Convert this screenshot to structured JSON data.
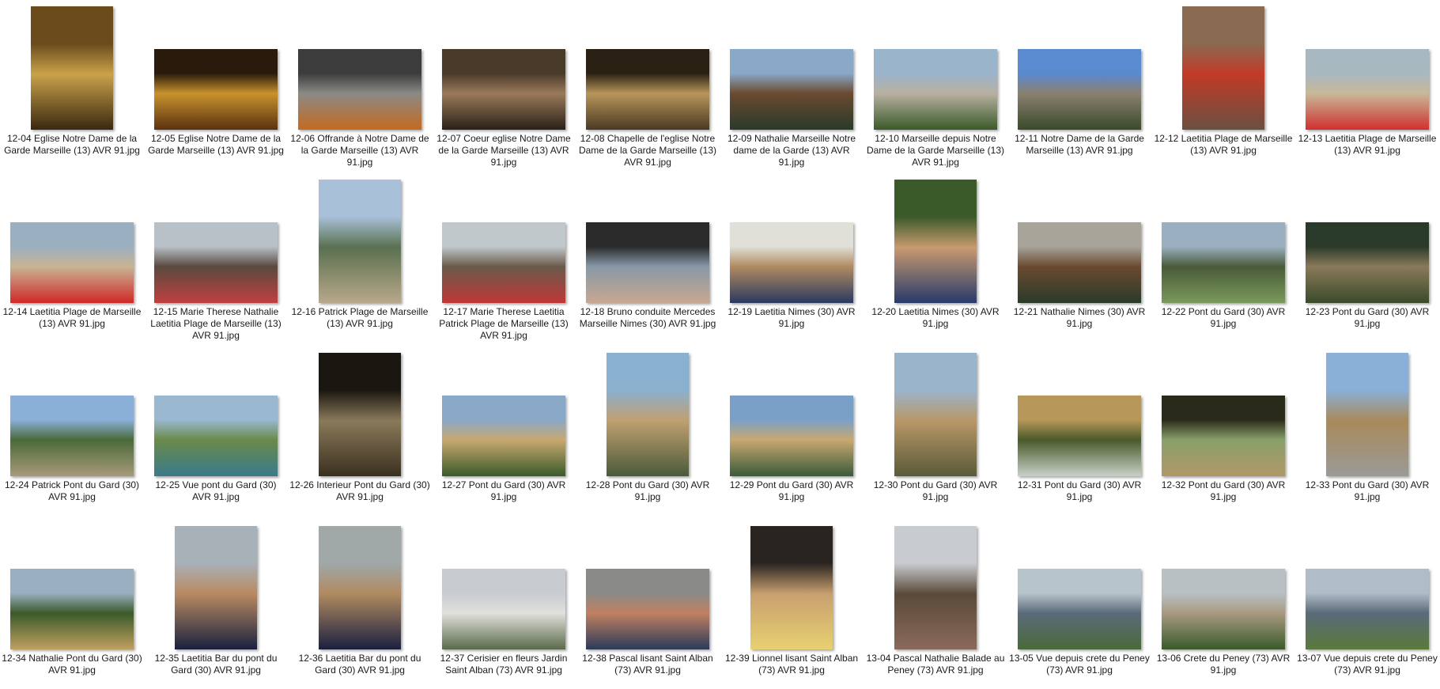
{
  "files": [
    {
      "name": "12-04 Eglise Notre Dame de la Garde Marseille (13) AVR 91.jpg",
      "orient": "v",
      "colors": [
        "#6b4a1c",
        "#c9a24a",
        "#3a2810"
      ]
    },
    {
      "name": "12-05 Eglise Notre Dame de la Garde Marseille (13) AVR 91.jpg",
      "orient": "h",
      "colors": [
        "#2a1a0c",
        "#c8922e",
        "#5a3210"
      ]
    },
    {
      "name": "12-06 Offrande à Notre Dame de la Garde Marseille (13) AVR 91.jpg",
      "orient": "h",
      "colors": [
        "#3c3c3c",
        "#8a8a86",
        "#c46a20"
      ]
    },
    {
      "name": "12-07 Coeur eglise Notre Dame de la Garde Marseille (13) AVR 91.jpg",
      "orient": "h",
      "colors": [
        "#4a3a2a",
        "#9a7a5a",
        "#2a2018"
      ]
    },
    {
      "name": "12-08 Chapelle de l'eglise Notre Dame de la Garde Marseille (13) AVR 91.jpg",
      "orient": "h",
      "colors": [
        "#2a2014",
        "#b8955a",
        "#4a3a22"
      ]
    },
    {
      "name": "12-09 Nathalie Marseille Notre dame de la Garde (13) AVR 91.jpg",
      "orient": "h",
      "colors": [
        "#8aa8c8",
        "#6a4a30",
        "#2a3a2a"
      ]
    },
    {
      "name": "12-10 Marseille depuis Notre Dame de la Garde Marseille (13) AVR 91.jpg",
      "orient": "h",
      "colors": [
        "#9ab4cc",
        "#b8b0a0",
        "#3a5a2a"
      ]
    },
    {
      "name": "12-11 Notre Dame de la Garde Marseille (13) AVR 91.jpg",
      "orient": "h",
      "colors": [
        "#5a8ad0",
        "#8a8070",
        "#3a4a2a"
      ]
    },
    {
      "name": "12-12 Laetitia Plage de Marseille (13) AVR 91.jpg",
      "orient": "v",
      "colors": [
        "#8a6a50",
        "#c23a28",
        "#6a5040"
      ]
    },
    {
      "name": "12-13 Laetitia Plage de Marseille (13) AVR 91.jpg",
      "orient": "h",
      "colors": [
        "#a8b8c0",
        "#c8b898",
        "#d03030"
      ]
    },
    {
      "name": "12-14 Laetitia Plage de Marseille (13) AVR 91.jpg",
      "orient": "h",
      "colors": [
        "#9ab0c0",
        "#c8b494",
        "#d02828"
      ]
    },
    {
      "name": "12-15 Marie Therese Nathalie Laetitia Plage de Marseille (13) AVR 91.jpg",
      "orient": "h",
      "colors": [
        "#b8c0c8",
        "#5a4a40",
        "#c04040"
      ]
    },
    {
      "name": "12-16 Patrick Plage de Marseille (13) AVR 91.jpg",
      "orient": "v",
      "colors": [
        "#a8c0d8",
        "#5a7050",
        "#b8a88a"
      ]
    },
    {
      "name": "12-17 Marie Therese Laetitia Patrick Plage de Marseille (13) AVR 91.jpg",
      "orient": "h",
      "colors": [
        "#c0c8cc",
        "#6a5a4a",
        "#c03838"
      ]
    },
    {
      "name": "12-18 Bruno conduite Mercedes Marseille Nimes (30) AVR 91.jpg",
      "orient": "h",
      "colors": [
        "#2a2a2a",
        "#8898a8",
        "#c8a890"
      ]
    },
    {
      "name": "12-19 Laetitia Nimes (30) AVR 91.jpg",
      "orient": "h",
      "colors": [
        "#e0e0d8",
        "#b08a60",
        "#2a3a60"
      ]
    },
    {
      "name": "12-20 Laetitia Nimes (30) AVR 91.jpg",
      "orient": "v",
      "colors": [
        "#3a5a2a",
        "#c89a70",
        "#283a6a"
      ]
    },
    {
      "name": "12-21 Nathalie Nimes (30) AVR 91.jpg",
      "orient": "h",
      "colors": [
        "#a8a49a",
        "#6a4a30",
        "#2a3a2a"
      ]
    },
    {
      "name": "12-22 Pont du Gard (30) AVR 91.jpg",
      "orient": "h",
      "colors": [
        "#9ab0c0",
        "#4a5a3a",
        "#7a9a5a"
      ]
    },
    {
      "name": "12-23 Pont du Gard (30) AVR 91.jpg",
      "orient": "h",
      "colors": [
        "#2a3a2a",
        "#8a7a5a",
        "#3a4a2a"
      ]
    },
    {
      "name": "12-24 Patrick Pont du Gard (30) AVR 91.jpg",
      "orient": "h",
      "colors": [
        "#8ab0d8",
        "#4a6a3a",
        "#a89a7a"
      ]
    },
    {
      "name": "12-25 Vue pont du Gard (30) AVR 91.jpg",
      "orient": "h",
      "colors": [
        "#9ab8d0",
        "#6a8a4a",
        "#3a7a8a"
      ]
    },
    {
      "name": "12-26 Interieur Pont du Gard (30) AVR 91.jpg",
      "orient": "v",
      "colors": [
        "#1a1610",
        "#8a7a5a",
        "#3a3020"
      ]
    },
    {
      "name": "12-27 Pont du Gard (30) AVR 91.jpg",
      "orient": "h",
      "colors": [
        "#8aa8c8",
        "#c8a870",
        "#3a5a2a"
      ]
    },
    {
      "name": "12-28 Pont du Gard (30) AVR 91.jpg",
      "orient": "v",
      "colors": [
        "#8ab0d0",
        "#c0a070",
        "#4a5a3a"
      ]
    },
    {
      "name": "12-29 Pont du Gard (30) AVR 91.jpg",
      "orient": "h",
      "colors": [
        "#7aa0c8",
        "#c8a870",
        "#3a5a3a"
      ]
    },
    {
      "name": "12-30 Pont du Gard (30) AVR 91.jpg",
      "orient": "v",
      "colors": [
        "#9ab4cc",
        "#b89868",
        "#5a5a3a"
      ]
    },
    {
      "name": "12-31 Pont du Gard (30) AVR 91.jpg",
      "orient": "h",
      "colors": [
        "#b8985a",
        "#4a5a2a",
        "#c8d0c8"
      ]
    },
    {
      "name": "12-32 Pont du Gard (30) AVR 91.jpg",
      "orient": "h",
      "colors": [
        "#2a2a1a",
        "#8aa06a",
        "#b09868"
      ]
    },
    {
      "name": "12-33 Pont du Gard (30) AVR 91.jpg",
      "orient": "v",
      "colors": [
        "#8ab0d8",
        "#a88a5a",
        "#9a9a98"
      ]
    },
    {
      "name": "12-34 Nathalie Pont du Gard (30) AVR 91.jpg",
      "orient": "h",
      "colors": [
        "#9ab0c0",
        "#3a5a2a",
        "#c0a060"
      ]
    },
    {
      "name": "12-35 Laetitia Bar du pont du Gard (30) AVR 91.jpg",
      "orient": "v",
      "colors": [
        "#a8b0b8",
        "#b88a60",
        "#1a2040"
      ]
    },
    {
      "name": "12-36 Laetitia Bar du pont du Gard (30) AVR 91.jpg",
      "orient": "v",
      "colors": [
        "#a0a8a8",
        "#b08a60",
        "#1a2040"
      ]
    },
    {
      "name": "12-37 Cerisier en fleurs Jardin Saint Alban (73) AVR 91.jpg",
      "orient": "h",
      "colors": [
        "#c8ccd0",
        "#e0e0dc",
        "#5a6a4a"
      ]
    },
    {
      "name": "12-38 Pascal lisant Saint Alban (73) AVR 91.jpg",
      "orient": "h",
      "colors": [
        "#8a8a88",
        "#c08060",
        "#2a3a5a"
      ]
    },
    {
      "name": "12-39 Lionnel lisant Saint Alban (73) AVR 91.jpg",
      "orient": "v",
      "colors": [
        "#2a2420",
        "#c8a070",
        "#e8d070"
      ]
    },
    {
      "name": "13-04 Pascal Nathalie Balade au Peney (73) AVR 91.jpg",
      "orient": "v",
      "colors": [
        "#c8ccd0",
        "#5a4a3a",
        "#8a6a5a"
      ]
    },
    {
      "name": "13-05 Vue depuis crete du Peney (73) AVR 91.jpg",
      "orient": "h",
      "colors": [
        "#b8c4cc",
        "#5a6a7a",
        "#4a6a3a"
      ]
    },
    {
      "name": "13-06 Crete du Peney (73) AVR 91.jpg",
      "orient": "h",
      "colors": [
        "#b8c0c4",
        "#a89a80",
        "#3a5a2a"
      ]
    },
    {
      "name": "13-07 Vue depuis crete du Peney (73) AVR 91.jpg",
      "orient": "h",
      "colors": [
        "#b0bcc8",
        "#5a6a7a",
        "#5a7a3a"
      ]
    }
  ]
}
